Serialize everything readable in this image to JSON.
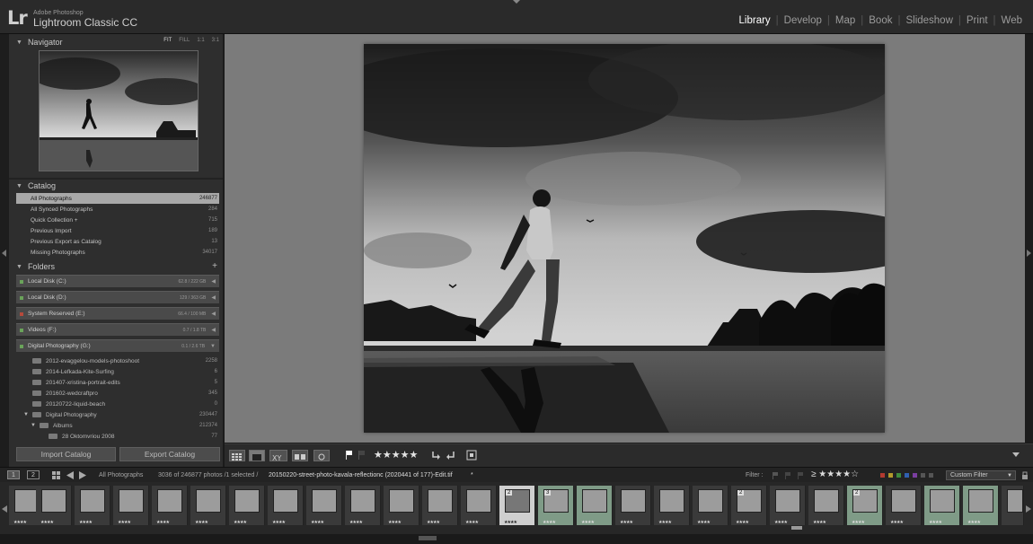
{
  "app": {
    "logo": "Lr",
    "brand_small": "Adobe Photoshop",
    "brand_large": "Lightroom Classic CC"
  },
  "modules": [
    "Library",
    "Develop",
    "Map",
    "Book",
    "Slideshow",
    "Print",
    "Web"
  ],
  "active_module": "Library",
  "navigator": {
    "title": "Navigator",
    "options": [
      "FIT",
      "FILL",
      "1:1",
      "3:1"
    ],
    "active_option": "FIT"
  },
  "catalog": {
    "title": "Catalog",
    "items": [
      {
        "label": "All Photographs",
        "count": "246877"
      },
      {
        "label": "All Synced Photographs",
        "count": "284"
      },
      {
        "label": "Quick Collection +",
        "count": "715"
      },
      {
        "label": "Previous Import",
        "count": "189"
      },
      {
        "label": "Previous Export as Catalog",
        "count": "13"
      },
      {
        "label": "Missing Photographs",
        "count": "34017"
      }
    ]
  },
  "folders": {
    "title": "Folders",
    "add": "+",
    "volumes": [
      {
        "label": "Local Disk (C:)",
        "size": "62.8 / 222 GB"
      },
      {
        "label": "Local Disk (D:)",
        "size": "129 / 363 GB"
      },
      {
        "label": "System Reserved (E:)",
        "size": "66.4 / 100 MB"
      },
      {
        "label": "Videos (F:)",
        "size": "0.7 / 1.8 TB"
      },
      {
        "label": "Digital Photography (G:)",
        "size": "0.1 / 2.6 TB"
      }
    ],
    "subfolders": [
      {
        "label": "2012-evaggelou-models-photoshoot",
        "count": "2258"
      },
      {
        "label": "2014-Lefkada-Kite-Surfing",
        "count": "6"
      },
      {
        "label": "201407-xristina-portrait-edits",
        "count": "5"
      },
      {
        "label": "201602-wedcraftpro",
        "count": "345"
      },
      {
        "label": "20120722-liquid-beach",
        "count": "0"
      },
      {
        "label": "Digital Photography",
        "count": "230447"
      },
      {
        "label": "Albums",
        "count": "212374"
      },
      {
        "label": "28 Oktomvriou 2008",
        "count": "77"
      }
    ]
  },
  "buttons": {
    "import": "Import Catalog",
    "export": "Export Catalog"
  },
  "toolbar": {
    "rating": "★★★★★"
  },
  "filmstrip_header": {
    "page1": "1",
    "page2": "2",
    "source": "All Photographs",
    "status": "3036 of 246877 photos /1 selected /",
    "filename": "20150220-street-photo-kavala-reflectionc (2020441 of 177)-Edit.tif",
    "star_marker": "*",
    "filter_label": "Filter :",
    "filter_stars": "≥ ★★★★☆",
    "custom_filter": "Custom Filter"
  },
  "filmstrip": {
    "thumb_stars": "★★★★",
    "badges": [
      "2",
      "3",
      "2",
      "2"
    ]
  }
}
